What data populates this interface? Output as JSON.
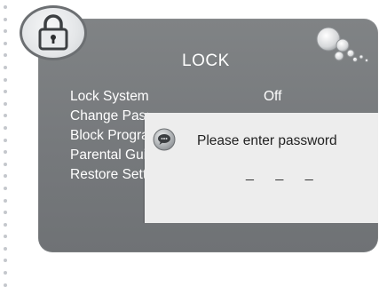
{
  "screen": {
    "title": "LOCK"
  },
  "menu": {
    "items": [
      {
        "label": "Lock System"
      },
      {
        "label": "Change Password"
      },
      {
        "label": "Block Program"
      },
      {
        "label": "Parental Guidance"
      },
      {
        "label": "Restore Settings"
      }
    ],
    "lock_system_value": "Off"
  },
  "dialog": {
    "message": "Please  enter password",
    "entry_mask": "_ _ _",
    "icon": "speech-bubble-icon"
  },
  "icons": {
    "badge": "padlock-icon",
    "decoration": "bubbles-icon"
  },
  "colors": {
    "panel": "#797c7f",
    "dialog": "#ededed",
    "text_light": "#ffffff",
    "text_dark": "#222222"
  }
}
